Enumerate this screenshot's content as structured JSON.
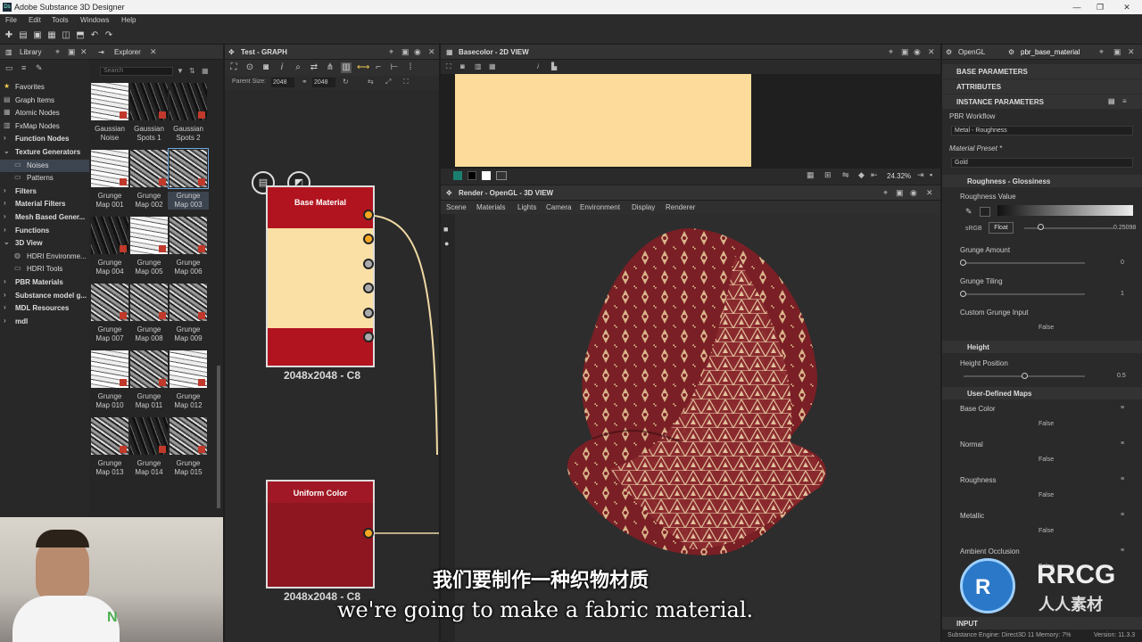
{
  "window": {
    "title": "Adobe Substance 3D Designer",
    "app_icon": "Ds"
  },
  "menu": [
    "File",
    "Edit",
    "Tools",
    "Windows",
    "Help"
  ],
  "library": {
    "tab": "Library",
    "items": [
      {
        "label": "Favorites",
        "bold": false,
        "icon": "star-icon"
      },
      {
        "label": "Graph Items",
        "bold": false,
        "icon": "graph-icon"
      },
      {
        "label": "Atomic Nodes",
        "bold": false,
        "icon": "atom-icon"
      },
      {
        "label": "FxMap Nodes",
        "bold": false,
        "icon": "fxmap-icon"
      },
      {
        "label": "Function Nodes",
        "bold": true,
        "icon": "chevron-right-icon"
      },
      {
        "label": "Texture Generators",
        "bold": true,
        "icon": "chevron-down-icon"
      },
      {
        "label": "Noises",
        "bold": false,
        "icon": "folder-icon"
      },
      {
        "label": "Patterns",
        "bold": false,
        "icon": "folder-icon"
      },
      {
        "label": "Filters",
        "bold": true,
        "icon": "chevron-right-icon"
      },
      {
        "label": "Material Filters",
        "bold": true,
        "icon": "chevron-right-icon"
      },
      {
        "label": "Mesh Based Gener...",
        "bold": true,
        "icon": "chevron-right-icon"
      },
      {
        "label": "Functions",
        "bold": true,
        "icon": "chevron-right-icon"
      },
      {
        "label": "3D View",
        "bold": true,
        "icon": "chevron-down-icon"
      },
      {
        "label": "HDRI Environme...",
        "bold": false,
        "icon": "globe-icon"
      },
      {
        "label": "HDRI Tools",
        "bold": false,
        "icon": "folder-icon"
      },
      {
        "label": "PBR Materials",
        "bold": true,
        "icon": "chevron-right-icon"
      },
      {
        "label": "Substance model g...",
        "bold": true,
        "icon": "chevron-right-icon"
      },
      {
        "label": "MDL Resources",
        "bold": true,
        "icon": "chevron-right-icon"
      },
      {
        "label": "mdl",
        "bold": true,
        "icon": "chevron-right-icon"
      }
    ]
  },
  "explorer": {
    "tab": "Explorer",
    "search_placeholder": "Search",
    "thumbnails": [
      [
        "Gaussian",
        "Noise"
      ],
      [
        "Gaussian",
        "Spots 1"
      ],
      [
        "Gaussian",
        "Spots 2"
      ],
      [
        "Grunge",
        "Map 001"
      ],
      [
        "Grunge",
        "Map 002"
      ],
      [
        "Grunge",
        "Map 003"
      ],
      [
        "Grunge",
        "Map 004"
      ],
      [
        "Grunge",
        "Map 005"
      ],
      [
        "Grunge",
        "Map 006"
      ],
      [
        "Grunge",
        "Map 007"
      ],
      [
        "Grunge",
        "Map 008"
      ],
      [
        "Grunge",
        "Map 009"
      ],
      [
        "Grunge",
        "Map 010"
      ],
      [
        "Grunge",
        "Map 011"
      ],
      [
        "Grunge",
        "Map 012"
      ],
      [
        "Grunge",
        "Map 013"
      ],
      [
        "Grunge",
        "Map 014"
      ],
      [
        "Grunge",
        "Map 015"
      ]
    ]
  },
  "graph": {
    "tab": "Test - GRAPH",
    "parent_size_label": "Parent Size:",
    "parent_size_value": "2048",
    "size_value": "2048",
    "nodes": [
      {
        "title": "Base Material",
        "caption": "2048x2048 - C8"
      },
      {
        "title": "Uniform Color",
        "caption": "2048x2048 - C8"
      }
    ]
  },
  "view2d": {
    "tab": "Basecolor - 2D VIEW",
    "zoom": "24.32%",
    "swatch_color": "#fddc9b"
  },
  "view3d": {
    "tab": "Render - OpenGL - 3D VIEW",
    "menu": [
      "Scene",
      "Materials",
      "Lights",
      "Camera",
      "Environment",
      "Display",
      "Renderer"
    ]
  },
  "props": {
    "tabs": [
      "OpenGL",
      "pbr_base_material"
    ],
    "sections": [
      "BASE PARAMETERS",
      "ATTRIBUTES",
      "INSTANCE PARAMETERS"
    ],
    "pbr_workflow_label": "PBR Workflow",
    "pbr_workflow_value": "Metal - Roughness",
    "material_preset_label": "Material Preset *",
    "material_preset_value": "Gold",
    "group_roughness": "Roughness - Glossiness",
    "roughness_value_label": "Roughness Value",
    "color_space": "sRGB",
    "float_label": "Float",
    "roughness_value": "0.25098",
    "grunge_amount_label": "Grunge Amount",
    "grunge_amount_value": "0",
    "grunge_tiling_label": "Grunge Tiling",
    "grunge_tiling_value": "1",
    "custom_grunge_label": "Custom Grunge Input",
    "custom_grunge_value": "False",
    "group_height": "Height",
    "height_position_label": "Height Position",
    "height_position_value": "0.5",
    "group_user_maps": "User-Defined Maps",
    "maps": [
      {
        "label": "Base Color",
        "value": "False"
      },
      {
        "label": "Normal",
        "value": "False"
      },
      {
        "label": "Roughness",
        "value": "False"
      },
      {
        "label": "Metallic",
        "value": "False"
      },
      {
        "label": "Ambient Occlusion",
        "value": "False"
      }
    ],
    "bottom_section": "INPUT"
  },
  "status": {
    "engine": "Substance Engine: Direct3D 11  Memory: 7%",
    "version": "Version: 11.3.3"
  },
  "subtitles": {
    "cn": "我们要制作一种织物材质",
    "en": "we're going to make a fabric material."
  },
  "watermark": {
    "brand": "RRCG",
    "brand_cn": "人人素材"
  }
}
